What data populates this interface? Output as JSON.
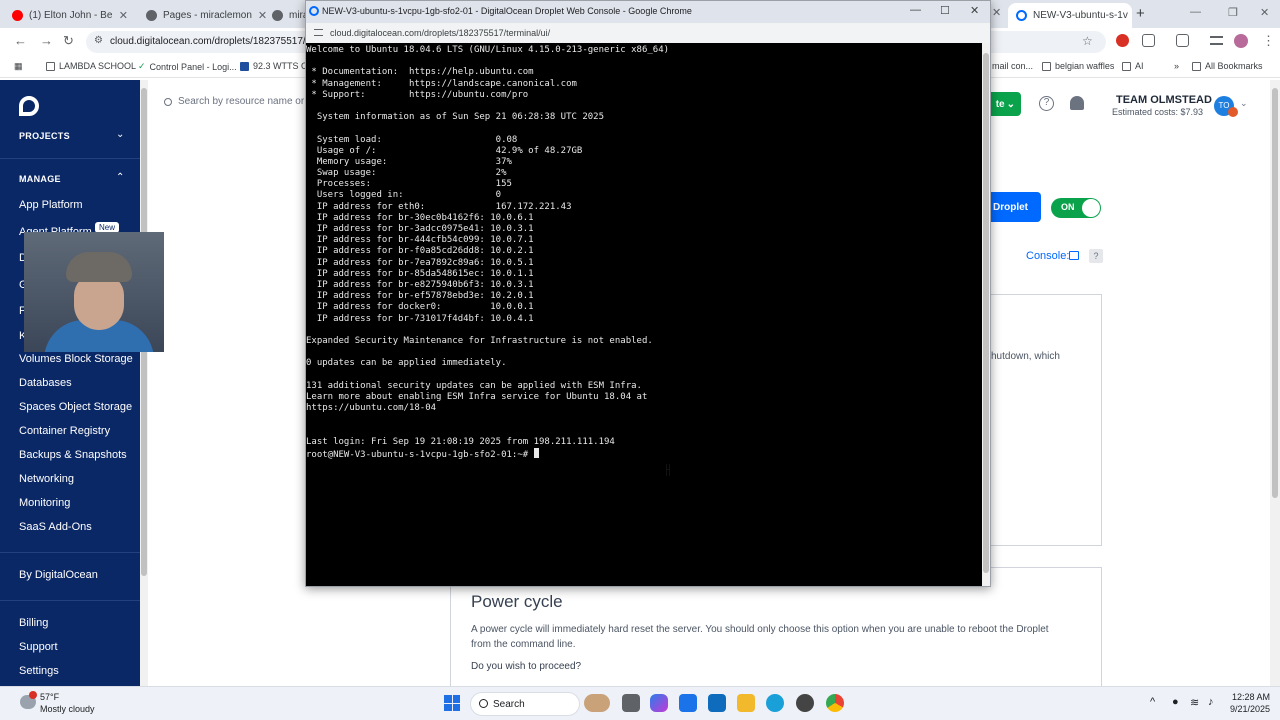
{
  "browser": {
    "tabs": [
      {
        "label": "(1) Elton John - Be"
      },
      {
        "label": "Pages - miraclemon"
      },
      {
        "label": "miraci"
      },
      {
        "label": "NEW-V3-ubuntu-s-1v"
      }
    ],
    "url": "cloud.digitalocean.com/droplets/182375517/po",
    "bookmarks": [
      {
        "label": "LAMBDA SCHOOL"
      },
      {
        "label": "Control Panel - Logi..."
      },
      {
        "label": "92.3 WTTS On"
      },
      {
        "label": "mail con..."
      },
      {
        "label": "belgian waffles"
      },
      {
        "label": "AI"
      },
      {
        "label": "»"
      },
      {
        "label": "All Bookmarks"
      }
    ]
  },
  "sidebar": {
    "projects_label": "PROJECTS",
    "manage_label": "MANAGE",
    "items": [
      {
        "label": "App Platform"
      },
      {
        "label": "Agent Platform"
      },
      {
        "label": "D"
      },
      {
        "label": "G"
      },
      {
        "label": "F"
      },
      {
        "label": "K"
      },
      {
        "label": "Volumes Block Storage"
      },
      {
        "label": "Databases"
      },
      {
        "label": "Spaces Object Storage"
      },
      {
        "label": "Container Registry"
      },
      {
        "label": "Backups & Snapshots"
      },
      {
        "label": "Networking"
      },
      {
        "label": "Monitoring"
      },
      {
        "label": "SaaS Add-Ons"
      }
    ],
    "new_badge": "New",
    "by_do": "By DigitalOcean",
    "footer": [
      {
        "label": "Billing"
      },
      {
        "label": "Support"
      },
      {
        "label": "Settings"
      }
    ]
  },
  "header": {
    "search_placeholder": "Search by resource name or",
    "create_label": "te",
    "team_name": "TEAM OLMSTEAD",
    "estimated_costs": "Estimated costs: $7.93",
    "avatar_initials": "TO"
  },
  "droplet_panel": {
    "droplet_button": "Droplet",
    "power_toggle": "ON",
    "console_link": "Console:",
    "help": "?",
    "shutdown_text": "hutdown, which",
    "power_cycle_title": "Power cycle",
    "power_cycle_body": "A power cycle will immediately hard reset the server. You should only choose this option when you are unable to reboot the Droplet from the command line.",
    "power_cycle_question": "Do you wish to proceed?"
  },
  "console_window": {
    "title": "NEW-V3-ubuntu-s-1vcpu-1gb-sfo2-01 - DigitalOcean Droplet Web Console - Google Chrome",
    "url": "cloud.digitalocean.com/droplets/182375517/terminal/ui/",
    "terminal_lines": [
      "Welcome to Ubuntu 18.04.6 LTS (GNU/Linux 4.15.0-213-generic x86_64)",
      "",
      " * Documentation:  https://help.ubuntu.com",
      " * Management:     https://landscape.canonical.com",
      " * Support:        https://ubuntu.com/pro",
      "",
      "  System information as of Sun Sep 21 06:28:38 UTC 2025",
      "",
      "  System load:                     0.08",
      "  Usage of /:                      42.9% of 48.27GB",
      "  Memory usage:                    37%",
      "  Swap usage:                      2%",
      "  Processes:                       155",
      "  Users logged in:                 0",
      "  IP address for eth0:             167.172.221.43",
      "  IP address for br-30ec0b4162f6: 10.0.6.1",
      "  IP address for br-3adcc0975e41: 10.0.3.1",
      "  IP address for br-444cfb54c099: 10.0.7.1",
      "  IP address for br-f0a85cd26dd8: 10.0.2.1",
      "  IP address for br-7ea7892c89a6: 10.0.5.1",
      "  IP address for br-85da548615ec: 10.0.1.1",
      "  IP address for br-e8275940b6f3: 10.0.3.1",
      "  IP address for br-ef57878ebd3e: 10.2.0.1",
      "  IP address for docker0:         10.0.0.1",
      "  IP address for br-731017f4d4bf: 10.0.4.1",
      "",
      "Expanded Security Maintenance for Infrastructure is not enabled.",
      "",
      "0 updates can be applied immediately.",
      "",
      "131 additional security updates can be applied with ESM Infra.",
      "Learn more about enabling ESM Infra service for Ubuntu 18.04 at",
      "https://ubuntu.com/18-04",
      "",
      "",
      "Last login: Fri Sep 19 21:08:19 2025 from 198.211.111.194"
    ],
    "prompt": "root@NEW-V3-ubuntu-s-1vcpu-1gb-sfo2-01:~# "
  },
  "taskbar": {
    "temperature": "57°F",
    "condition": "Mostly cloudy",
    "search_label": "Search",
    "time": "12:28 AM",
    "date": "9/21/2025"
  },
  "colors": {
    "sidebar_bg": "#0b2866",
    "do_blue": "#0069ff",
    "green": "#0aa34b",
    "terminal_bg": "#000000"
  }
}
